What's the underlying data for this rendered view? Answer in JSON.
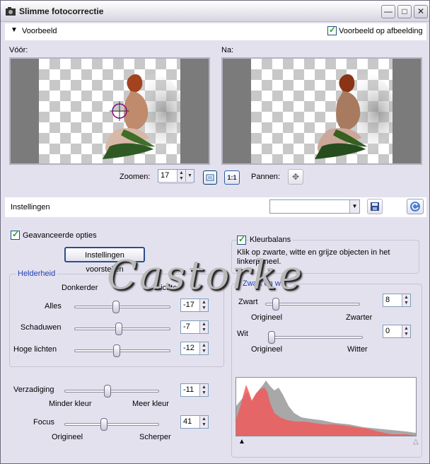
{
  "window": {
    "title": "Slimme fotocorrectie",
    "buttons": {
      "minimize": "—",
      "maximize": "□",
      "close": "✕"
    }
  },
  "preview": {
    "section_label": "Voorbeeld",
    "preview_on_image_label": "Voorbeeld op afbeelding",
    "preview_on_image_checked": true,
    "before_label": "Vóór:",
    "after_label": "Na:",
    "zoom_label": "Zoomen:",
    "zoom_value": "17",
    "pan_label": "Pannen:"
  },
  "settings_bar": {
    "label": "Instellingen",
    "preset_value": ""
  },
  "advanced": {
    "label": "Geavanceerde opties",
    "checked": true,
    "suggest_button": "Instellingen voorstellen"
  },
  "brightness": {
    "group_title": "Helderheid",
    "darker_label": "Donkerder",
    "lighter_label": "Lichter",
    "rows": [
      {
        "label": "Alles",
        "value": "-17",
        "level": 0.43
      },
      {
        "label": "Schaduwen",
        "value": "-7",
        "level": 0.46
      },
      {
        "label": "Hoge lichten",
        "value": "-12",
        "level": 0.44
      }
    ]
  },
  "saturation": {
    "label": "Verzadiging",
    "value": "-11",
    "level": 0.45,
    "min_label": "Minder kleur",
    "max_label": "Meer kleur"
  },
  "focus": {
    "label": "Focus",
    "value": "41",
    "level": 0.41,
    "min_label": "Origineel",
    "max_label": "Scherper"
  },
  "color_balance": {
    "label": "Kleurbalans",
    "checked": true,
    "hint": "Klik op zwarte, witte en grijze objecten in het linkerpaneel."
  },
  "black_white": {
    "group_title": "Zwart en wit",
    "black": {
      "label": "Zwart",
      "value": "8",
      "level": 0.08,
      "min_label": "Origineel",
      "max_label": "Zwarter"
    },
    "white": {
      "label": "Wit",
      "value": "0",
      "level": 0.0,
      "min_label": "Origineel",
      "max_label": "Witter"
    }
  },
  "watermark": {
    "text": "Castorke"
  },
  "colors": {
    "window_bg": "#e4e1ef",
    "group_title": "#1d3fae",
    "histogram_red": "#f05a5a",
    "histogram_gray": "#a8a8a8"
  }
}
